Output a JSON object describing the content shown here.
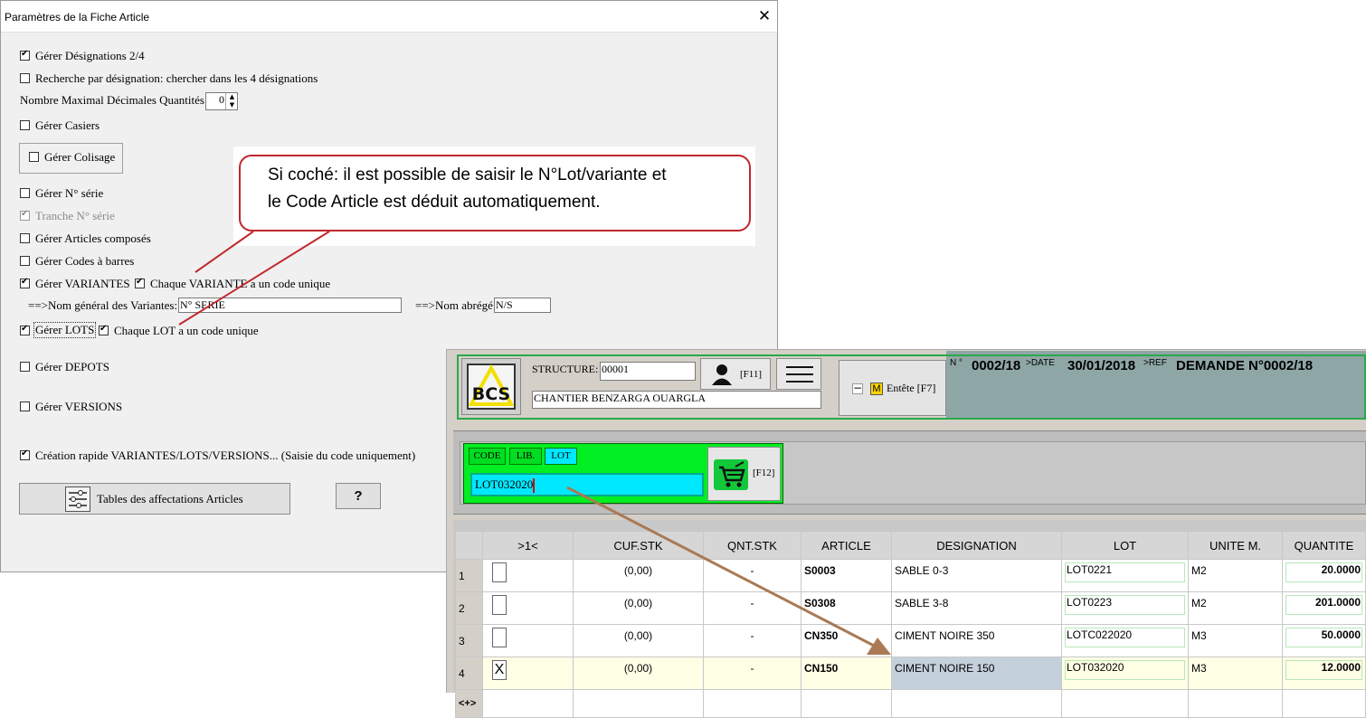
{
  "dialog": {
    "title": "Paramètres de la Fiche Article",
    "close": "✕",
    "options": {
      "designations": "Gérer Désignations 2/4",
      "recherche": "Recherche par désignation: chercher dans les 4 désignations",
      "decimales_label": "Nombre Maximal Décimales Quantités:",
      "decimales_value": "0",
      "casiers": "Gérer Casiers",
      "colisage": "Gérer Colisage",
      "serie": "Gérer N° série",
      "tranche": "Tranche N° série",
      "composes": "Gérer Articles composés",
      "codes_barres": "Gérer Codes à barres",
      "variantes": "Gérer VARIANTES",
      "variante_unique": "Chaque VARIANTE a un code unique",
      "nom_general_label": "==>Nom général des Variantes:",
      "nom_general_value": "N° SERIE",
      "nom_abrege_label": "==>Nom abrégé:",
      "nom_abrege_value": "N/S",
      "lots": "Gérer LOTS",
      "lot_unique": "Chaque LOT a un code unique",
      "depots": "Gérer DEPOTS",
      "versions": "Gérer VERSIONS",
      "creation_rapide": "Création rapide VARIANTES/LOTS/VERSIONS... (Saisie du code uniquement)"
    },
    "tables_button": "Tables des affectations Articles",
    "help_button": "?"
  },
  "callout": {
    "line1": "Si coché: il est possible de saisir le N°Lot/variante et",
    "line2": "le Code Article est déduit automatiquement."
  },
  "app": {
    "logo": "BCS",
    "structure_label": "STRUCTURE:",
    "structure_value": "00001",
    "structure_name": "CHANTIER BENZARGA OUARGLA",
    "user_key": "[F11]",
    "entete_m": "M",
    "entete_label": "Entête [F7]",
    "no_label": "N °",
    "no_value": "0002/18",
    "date_label": ">DATE",
    "date_value": "30/01/2018",
    "ref_label": ">REF",
    "ref_value": "DEMANDE N°0002/18",
    "search_tabs": [
      "CODE",
      "LIB.",
      "LOT"
    ],
    "search_value": "LOT032020",
    "cart_key": "[F12]",
    "columns": [
      ">1<",
      "CUF.STK",
      "QNT.STK",
      "ARTICLE",
      "DESIGNATION",
      "LOT",
      "UNITE M.",
      "QUANTITE"
    ],
    "rows": [
      {
        "n": "1",
        "check": "",
        "cuf": "(0,00)",
        "qnt": "-",
        "article": "S0003",
        "designation": "SABLE 0-3",
        "lot": "LOT0221",
        "unite": "M2",
        "quantite": "20.0000"
      },
      {
        "n": "2",
        "check": "",
        "cuf": "(0,00)",
        "qnt": "-",
        "article": "S0308",
        "designation": "SABLE 3-8",
        "lot": "LOT0223",
        "unite": "M2",
        "quantite": "201.0000"
      },
      {
        "n": "3",
        "check": "",
        "cuf": "(0,00)",
        "qnt": "-",
        "article": "CN350",
        "designation": "CIMENT NOIRE 350",
        "lot": "LOTC022020",
        "unite": "M3",
        "quantite": "50.0000"
      },
      {
        "n": "4",
        "check": "X",
        "cuf": "(0,00)",
        "qnt": "-",
        "article": "CN150",
        "designation": "CIMENT NOIRE 150",
        "lot": "LOT032020",
        "unite": "M3",
        "quantite": "12.0000"
      }
    ],
    "new_row": "<+>"
  },
  "colors": {
    "green": "#00ee22",
    "cyan": "#00e8ff",
    "arrow": "#a97a55",
    "callout_border": "#c0282d"
  }
}
